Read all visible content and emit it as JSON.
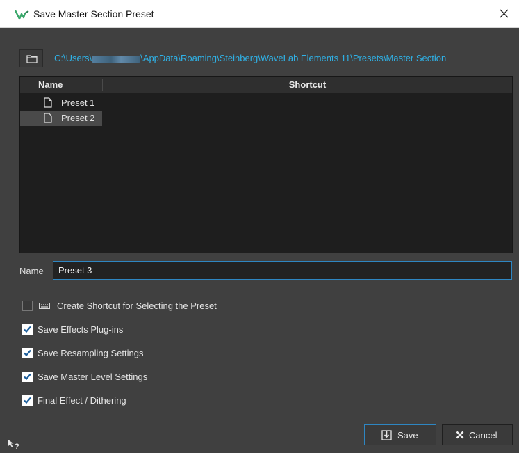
{
  "window": {
    "title": "Save Master Section Preset"
  },
  "path": {
    "prefix": "C:\\Users\\",
    "suffix": "\\AppData\\Roaming\\Steinberg\\WaveLab Elements 11\\Presets\\Master Section"
  },
  "table": {
    "columns": [
      "Name",
      "Shortcut"
    ],
    "rows": [
      {
        "name": "Preset 1",
        "selected": false
      },
      {
        "name": "Preset 2",
        "selected": true
      }
    ]
  },
  "name_field": {
    "label": "Name",
    "value": "Preset 3"
  },
  "options": [
    {
      "label": "Create Shortcut for Selecting the Preset",
      "checked": false
    },
    {
      "label": "Save Effects Plug-ins",
      "checked": true
    },
    {
      "label": "Save Resampling Settings",
      "checked": true
    },
    {
      "label": "Save Master Level Settings",
      "checked": true
    },
    {
      "label": "Final Effect / Dithering",
      "checked": true
    }
  ],
  "buttons": {
    "save": "Save",
    "cancel": "Cancel"
  },
  "colors": {
    "accent": "#2fb1e6",
    "focus_border": "#2e86c2",
    "background": "#404040"
  }
}
